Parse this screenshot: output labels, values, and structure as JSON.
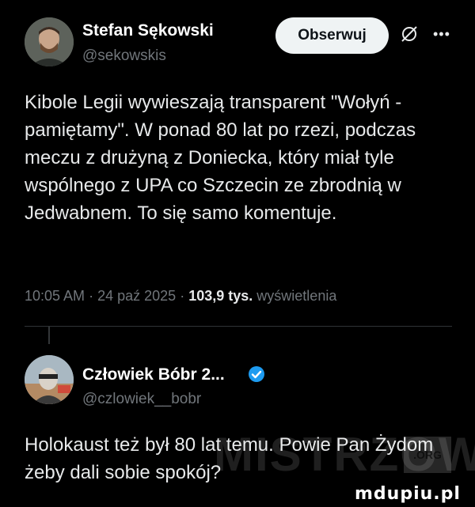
{
  "post": {
    "author_name": "Stefan Sękowski",
    "author_handle": "@sekowskis",
    "follow_label": "Obserwuj",
    "text": "Kibole Legii wywieszają transparent \"Wołyń - pamiętamy\". W ponad 80 lat po rzezi, podczas meczu z drużyną z Doniecka, który miał tyle wspólnego z UPA co Szczecin ze zbrodnią w Jedwabnem. To się samo komentuje.",
    "time": "10:05 AM",
    "date": "24 paź 2025",
    "views_count": "103,9 tys.",
    "views_label": "wyświetlenia",
    "separator": "·"
  },
  "reply": {
    "author_name": "Człowiek Bóbr 2...",
    "author_handle": "@czlowiek__bobr",
    "text": "Holokaust też był 80 lat temu. Powie Pan Żydom żeby dali sobie spokój?"
  },
  "watermark": {
    "text": "MISTRZOWIE",
    "badge": ".ORG",
    "site": "mdupiu.pl"
  },
  "colors": {
    "background": "#000000",
    "text": "#e7e9ea",
    "muted": "#71767b",
    "verified": "#1d9bf0"
  }
}
